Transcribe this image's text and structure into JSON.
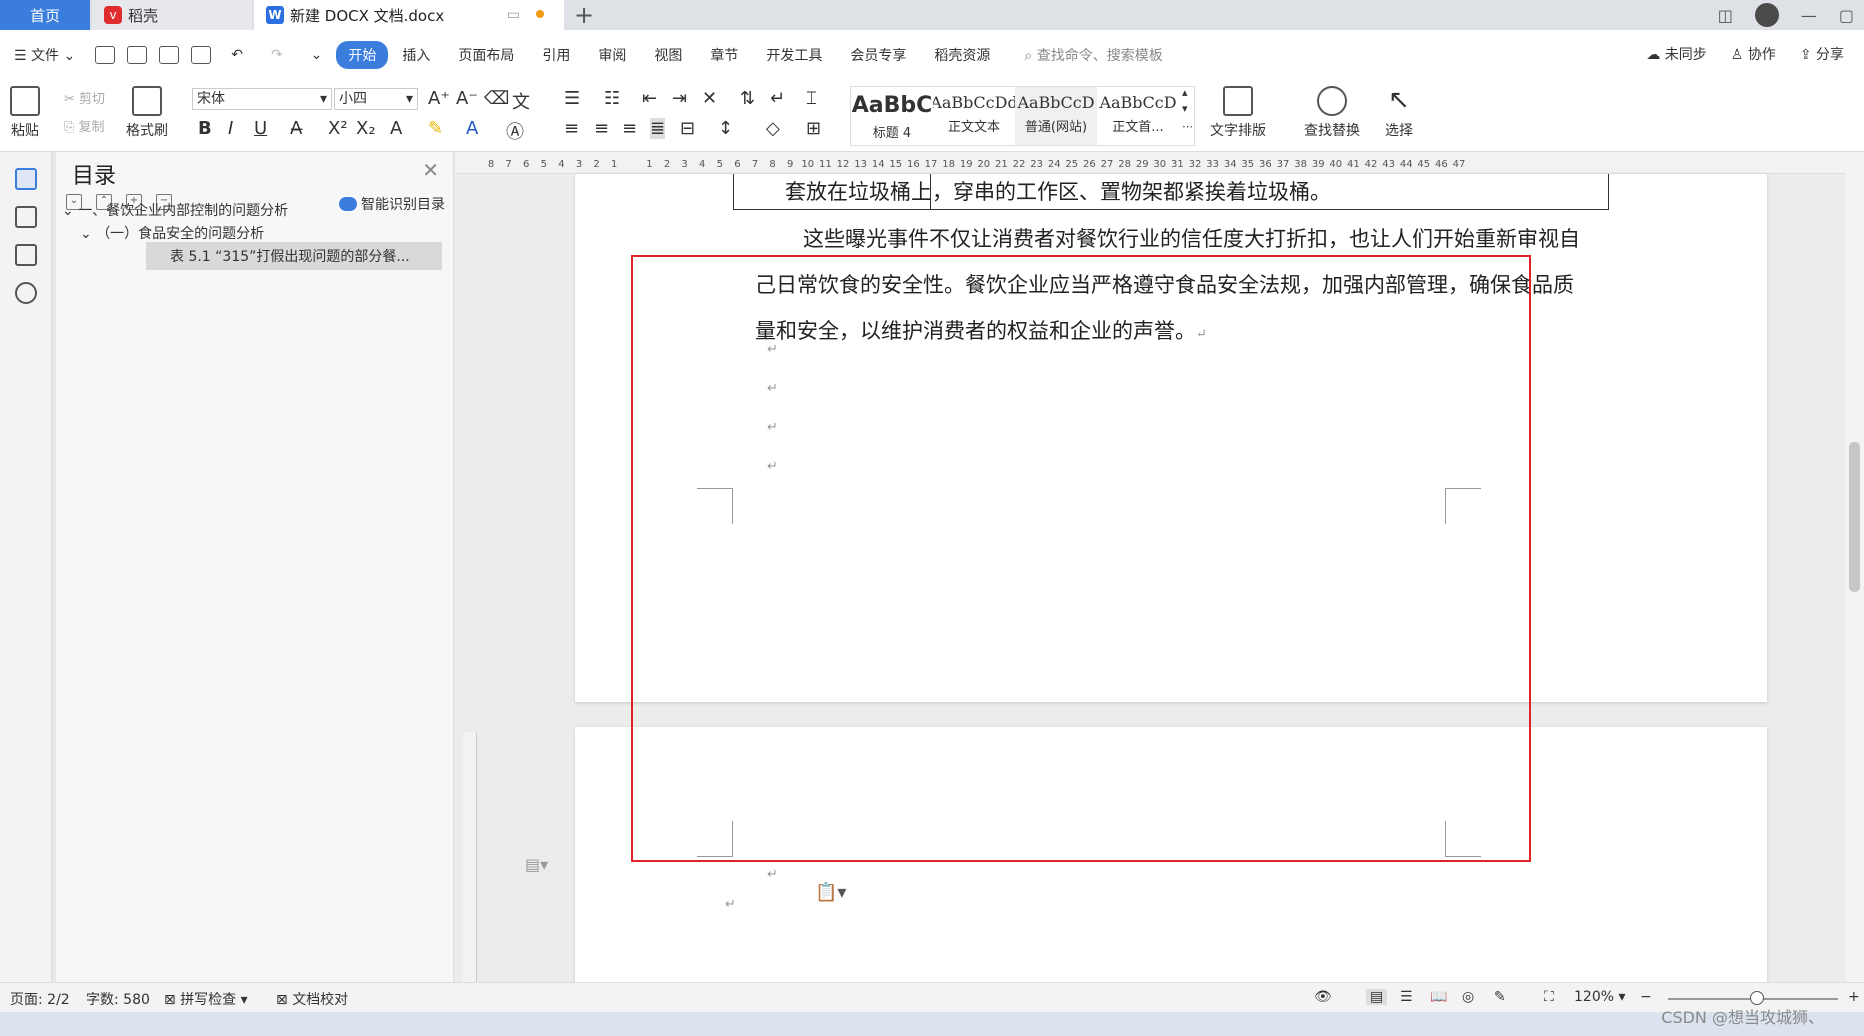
{
  "tabs": {
    "home": "首页",
    "daoke": "稻壳",
    "document": "新建 DOCX 文档.docx",
    "add": "+"
  },
  "menu": {
    "file": "文件",
    "items": [
      "开始",
      "插入",
      "页面布局",
      "引用",
      "审阅",
      "视图",
      "章节",
      "开发工具",
      "会员专享",
      "稻壳资源"
    ],
    "search": "查找命令、搜索模板",
    "right": [
      "未同步",
      "协作",
      "分享"
    ]
  },
  "ribbon": {
    "paste": "粘贴",
    "cut": "剪切",
    "copy": "复制",
    "format_painter": "格式刷",
    "font_name": "宋体",
    "font_size": "小四",
    "styles": [
      {
        "sample": "AaBbC",
        "name": "标题 4"
      },
      {
        "sample": "AaBbCcDd",
        "name": "正文文本"
      },
      {
        "sample": "AaBbCcD",
        "name": "普通(网站)"
      },
      {
        "sample": "AaBbCcD",
        "name": "正文首..."
      }
    ],
    "text_layout": "文字排版",
    "find_replace": "查找替换",
    "select": "选择"
  },
  "toc": {
    "title": "目录",
    "smart": "智能识别目录",
    "items": [
      "一、餐饮企业内部控制的问题分析",
      "（一）食品安全的问题分析",
      "表 5.1 “315”打假出现问题的部分餐..."
    ]
  },
  "ruler": {
    "ticks": [
      "8",
      "7",
      "6",
      "5",
      "4",
      "3",
      "2",
      "1",
      "",
      "1",
      "2",
      "3",
      "4",
      "5",
      "6",
      "7",
      "8",
      "9",
      "10",
      "11",
      "12",
      "13",
      "14",
      "15",
      "16",
      "17",
      "18",
      "19",
      "20",
      "21",
      "22",
      "23",
      "24",
      "25",
      "26",
      "27",
      "28",
      "29",
      "30",
      "31",
      "32",
      "33",
      "34",
      "35",
      "36",
      "37",
      "38",
      "39",
      "40",
      "41",
      "42",
      "43",
      "44",
      "45",
      "46",
      "47"
    ]
  },
  "document": {
    "table_fragment": "套放在垃圾桶上，穿串的工作区、置物架都紧挨着垃圾桶。",
    "paragraph": "这些曝光事件不仅让消费者对餐饮行业的信任度大打折扣，也让人们开始重新审视自己日常饮食的安全性。餐饮企业应当严格遵守食品安全法规，加强内部管理，确保食品质量和安全，以维护消费者的权益和企业的声誉。",
    "return_mark": "↵"
  },
  "status": {
    "page": "页面: 2/2",
    "words": "字数: 580",
    "spell": "拼写检查",
    "proof": "文档校对",
    "zoom": "120%"
  },
  "watermark": "CSDN @想当攻城狮、",
  "colors": {
    "accent": "#3b7ddd",
    "selection_box": "#e0222a"
  }
}
